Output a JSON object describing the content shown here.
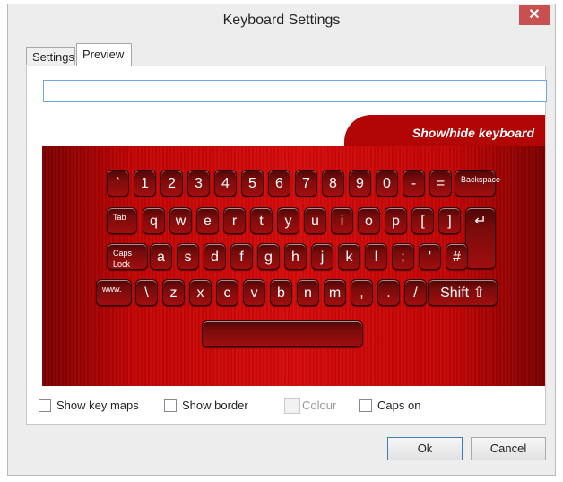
{
  "window": {
    "title": "Keyboard Settings",
    "close_label": "✕"
  },
  "tabs": [
    {
      "label": "Settings"
    },
    {
      "label": "Preview"
    }
  ],
  "preview": {
    "input_value": "",
    "keyboard": {
      "show_hide_label": "Show/hide keyboard",
      "row1": [
        "`",
        "1",
        "2",
        "3",
        "4",
        "5",
        "6",
        "7",
        "8",
        "9",
        "0",
        "-",
        "=",
        "Backspace"
      ],
      "row2": [
        "Tab",
        "q",
        "w",
        "e",
        "r",
        "t",
        "y",
        "u",
        "i",
        "o",
        "p",
        "[",
        "]",
        "↵"
      ],
      "row3": [
        "Caps Lock",
        "a",
        "s",
        "d",
        "f",
        "g",
        "h",
        "j",
        "k",
        "l",
        ";",
        "'",
        "#"
      ],
      "row4": [
        "www.",
        "\\",
        "z",
        "x",
        "c",
        "v",
        "b",
        "n",
        "m",
        ",",
        ".",
        "/",
        "Shift ⇧"
      ],
      "space": ""
    }
  },
  "options": {
    "show_key_maps": {
      "label": "Show key maps",
      "checked": false
    },
    "show_border": {
      "label": "Show border",
      "checked": false
    },
    "colour": {
      "label": "Colour",
      "enabled": false
    },
    "caps_on": {
      "label": "Caps on",
      "checked": false
    }
  },
  "buttons": {
    "ok": "Ok",
    "cancel": "Cancel"
  }
}
